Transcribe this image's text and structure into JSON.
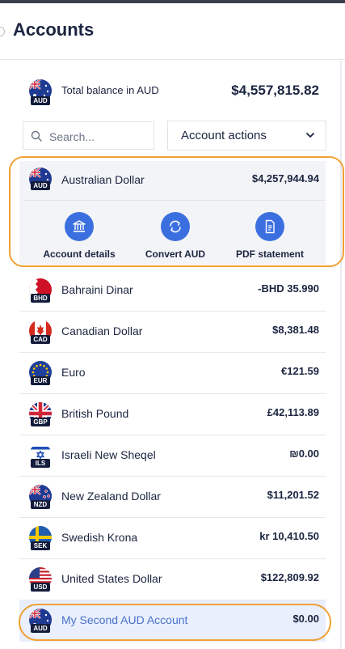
{
  "header": {
    "title": "Accounts"
  },
  "total": {
    "code": "AUD",
    "label": "Total balance in AUD",
    "value": "$4,557,815.82"
  },
  "search": {
    "placeholder": "Search..."
  },
  "actions": {
    "label": "Account actions"
  },
  "selected_account": {
    "code": "AUD",
    "name": "Australian Dollar",
    "amount": "$4,257,944.94",
    "quick_actions": [
      {
        "label": "Account details",
        "icon": "bank-icon"
      },
      {
        "label": "Convert AUD",
        "icon": "convert-icon"
      },
      {
        "label": "PDF statement",
        "icon": "document-icon"
      }
    ]
  },
  "accounts": [
    {
      "code": "BHD",
      "name": "Bahraini Dinar",
      "amount": "-BHD 35.990"
    },
    {
      "code": "CAD",
      "name": "Canadian Dollar",
      "amount": "$8,381.48"
    },
    {
      "code": "EUR",
      "name": "Euro",
      "amount": "€121.59"
    },
    {
      "code": "GBP",
      "name": "British Pound",
      "amount": "£42,113.89"
    },
    {
      "code": "ILS",
      "name": "Israeli New Sheqel",
      "amount": "₪0.00"
    },
    {
      "code": "NZD",
      "name": "New Zealand Dollar",
      "amount": "$11,201.52"
    },
    {
      "code": "SEK",
      "name": "Swedish Krona",
      "amount": "kr 10,410.50"
    },
    {
      "code": "USD",
      "name": "United States Dollar",
      "amount": "$122,809.92"
    },
    {
      "code": "AUD",
      "name": "My Second AUD Account",
      "amount": "$0.00"
    }
  ],
  "colors": {
    "accent": "#3b6fe0",
    "highlight": "#f0a134",
    "selected_row": "#e9effd",
    "text": "#1b2540"
  }
}
